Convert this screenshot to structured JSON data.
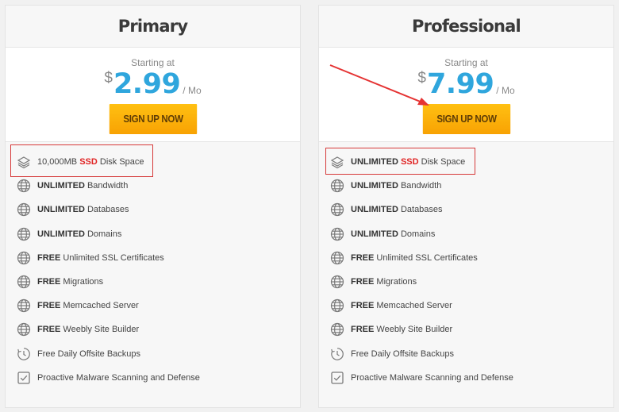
{
  "plans": [
    {
      "title": "Primary",
      "starting_label": "Starting at",
      "currency": "$",
      "price": "2.99",
      "period": "/ Mo",
      "cta": "SIGN UP NOW",
      "features": [
        {
          "icon": "layers-icon",
          "bold": "",
          "main": "10,000MB ",
          "ssd": "SSD",
          "rest": " Disk Space"
        },
        {
          "icon": "globe-icon",
          "bold": "UNLIMITED",
          "rest": " Bandwidth"
        },
        {
          "icon": "globe-icon",
          "bold": "UNLIMITED",
          "rest": " Databases"
        },
        {
          "icon": "globe-icon",
          "bold": "UNLIMITED",
          "rest": " Domains"
        },
        {
          "icon": "globe-icon",
          "bold": "FREE",
          "rest": " Unlimited SSL Certificates"
        },
        {
          "icon": "globe-icon",
          "bold": "FREE",
          "rest": " Migrations"
        },
        {
          "icon": "globe-icon",
          "bold": "FREE",
          "rest": " Memcached Server"
        },
        {
          "icon": "globe-icon",
          "bold": "FREE",
          "rest": " Weebly Site Builder"
        },
        {
          "icon": "backup-clock-icon",
          "bold": "",
          "rest": "Free Daily Offsite Backups"
        },
        {
          "icon": "checkbox-icon",
          "bold": "",
          "rest": "Proactive Malware Scanning and Defense"
        }
      ]
    },
    {
      "title": "Professional",
      "starting_label": "Starting at",
      "currency": "$",
      "price": "7.99",
      "period": "/ Mo",
      "cta": "SIGN UP NOW",
      "features": [
        {
          "icon": "layers-icon",
          "bold": "UNLIMITED",
          "main": " ",
          "ssd": "SSD",
          "rest": " Disk Space"
        },
        {
          "icon": "globe-icon",
          "bold": "UNLIMITED",
          "rest": " Bandwidth"
        },
        {
          "icon": "globe-icon",
          "bold": "UNLIMITED",
          "rest": " Databases"
        },
        {
          "icon": "globe-icon",
          "bold": "UNLIMITED",
          "rest": " Domains"
        },
        {
          "icon": "globe-icon",
          "bold": "FREE",
          "rest": " Unlimited SSL Certificates"
        },
        {
          "icon": "globe-icon",
          "bold": "FREE",
          "rest": " Migrations"
        },
        {
          "icon": "globe-icon",
          "bold": "FREE",
          "rest": " Memcached Server"
        },
        {
          "icon": "globe-icon",
          "bold": "FREE",
          "rest": " Weebly Site Builder"
        },
        {
          "icon": "backup-clock-icon",
          "bold": "",
          "rest": "Free Daily Offsite Backups"
        },
        {
          "icon": "checkbox-icon",
          "bold": "",
          "rest": "Proactive Malware Scanning and Defense"
        }
      ]
    }
  ],
  "colors": {
    "price": "#2fa6dd",
    "cta": "#fbb20b",
    "ssd": "#e02424",
    "annotation": "#d63a3a"
  }
}
